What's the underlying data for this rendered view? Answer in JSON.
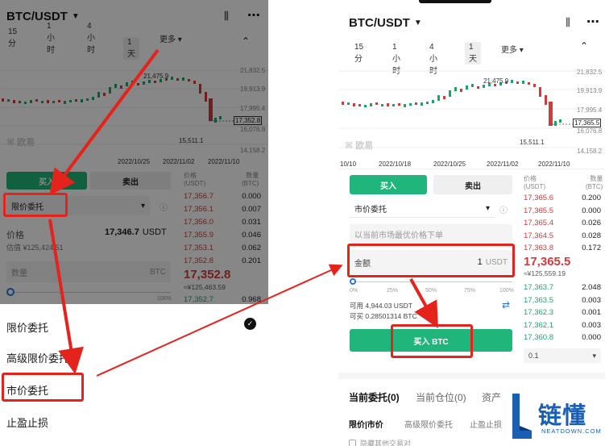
{
  "left": {
    "pair": "BTC/USDT",
    "timeframes": [
      "15分",
      "1小时",
      "4小时",
      "1天",
      "更多"
    ],
    "selected_timeframe": "1天",
    "chart_labels": {
      "high": "21,475.9",
      "low": "15,511.1",
      "dates": [
        "2022/10/25",
        "2022/11/02",
        "2022/11/10"
      ]
    },
    "price_axis": [
      "21,832.5",
      "19,913.9",
      "17,995.4",
      "16,076.8",
      "14,158.2"
    ],
    "current_price_tag": "17,352.8",
    "watermark": "欧易",
    "buy_tab": "买入",
    "sell_tab": "卖出",
    "order_type": "限价委托",
    "price_label": "价格",
    "price_value": "17,346.7",
    "price_unit": "USDT",
    "estimate": "估值 ¥125,424.51",
    "qty_placeholder": "数量",
    "qty_unit": "BTC",
    "book_header": {
      "price": "价格",
      "price_unit": "(USDT)",
      "amount": "数量",
      "amount_unit": "(BTC)"
    },
    "asks": [
      {
        "p": "17,356.7",
        "a": "0.000"
      },
      {
        "p": "17,356.1",
        "a": "0.007"
      },
      {
        "p": "17,356.0",
        "a": "0.031"
      },
      {
        "p": "17,355.9",
        "a": "0.046"
      },
      {
        "p": "17,353.1",
        "a": "0.062"
      },
      {
        "p": "17,352.8",
        "a": "0.201"
      }
    ],
    "mid_price": "17,352.8",
    "mid_cny": "≈¥125,463.59",
    "bid": {
      "p": "17,352.7",
      "a": "0.968"
    },
    "pct_labels": [
      "0%",
      "100%"
    ],
    "menu": [
      "限价委托",
      "高级限价委托",
      "市价委托",
      "止盈止损"
    ]
  },
  "right": {
    "pair": "BTC/USDT",
    "timeframes": [
      "15分",
      "1小时",
      "4小时",
      "1天",
      "更多"
    ],
    "selected_timeframe": "1天",
    "chart_labels": {
      "high": "21,475.9",
      "low": "15,511.1",
      "dates": [
        "10/10",
        "2022/10/18",
        "2022/10/25",
        "2022/11/02",
        "2022/11/10"
      ]
    },
    "price_axis": [
      "21,832.5",
      "19,913.9",
      "17,995.4",
      "16,076.8",
      "14,158.2"
    ],
    "current_price_tag": "17,365.5",
    "watermark": "欧易",
    "buy_tab": "买入",
    "sell_tab": "卖出",
    "order_type": "市价委托",
    "market_placeholder": "以当前市场最优价格下单",
    "amount_label": "金额",
    "amount_value": "1",
    "amount_unit": "USDT",
    "pct_labels": [
      "0%",
      "25%",
      "50%",
      "75%",
      "100%"
    ],
    "available": "可用  4,944.03 USDT",
    "can_buy": "可买  0.28501314 BTC",
    "buy_button": "买入 BTC",
    "book_header": {
      "price": "价格",
      "price_unit": "(USDT)",
      "amount": "数量",
      "amount_unit": "(BTC)"
    },
    "asks": [
      {
        "p": "17,365.6",
        "a": "0.200"
      },
      {
        "p": "17,365.5",
        "a": "0.000"
      },
      {
        "p": "17,365.4",
        "a": "0.026"
      },
      {
        "p": "17,364.5",
        "a": "0.028"
      },
      {
        "p": "17,363.8",
        "a": "0.172"
      }
    ],
    "mid_price": "17,365.5",
    "mid_cny": "≈¥125,559.19",
    "bids": [
      {
        "p": "17,363.7",
        "a": "2.048"
      },
      {
        "p": "17,363.5",
        "a": "0.003"
      },
      {
        "p": "17,362.3",
        "a": "0.001"
      },
      {
        "p": "17,362.1",
        "a": "0.003"
      },
      {
        "p": "17,360.8",
        "a": "0.000"
      }
    ],
    "depth_select": "0.1",
    "bottom_tabs": [
      "当前委托(0)",
      "当前仓位(0)",
      "资产"
    ],
    "sub_tabs": [
      "限价|市价",
      "高级限价委托",
      "止盈止损"
    ],
    "checkbox_label": "隐藏其他交易对"
  },
  "logo": {
    "text": "链懂",
    "sub": "NEATDOWN.COM"
  },
  "colors": {
    "green": "#20b57a",
    "red": "#d33b3b",
    "annotation": "#e5231d"
  }
}
